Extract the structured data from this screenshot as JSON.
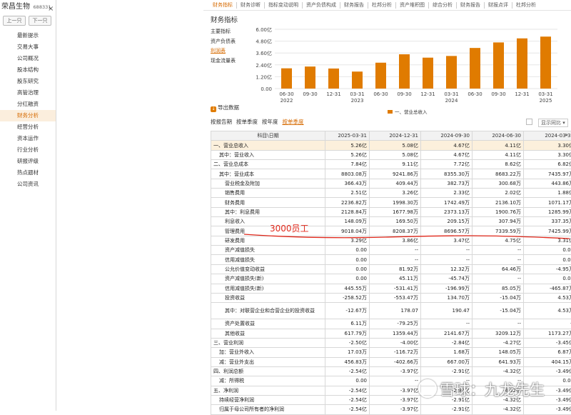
{
  "stock": {
    "name": "荣昌生物",
    "code": "688331",
    "close": "×"
  },
  "nav_buttons": {
    "prev": "上一只",
    "next": "下一只"
  },
  "sidebar": {
    "items": [
      {
        "label": "最新提示"
      },
      {
        "label": "交易大事"
      },
      {
        "label": "公司概况"
      },
      {
        "label": "股本结构"
      },
      {
        "label": "股东研究"
      },
      {
        "label": "高管治理"
      },
      {
        "label": "分红融资"
      },
      {
        "label": "财务分析",
        "active": true
      },
      {
        "label": "经营分析"
      },
      {
        "label": "资本运作"
      },
      {
        "label": "行业分析"
      },
      {
        "label": "研报评级"
      },
      {
        "label": "热点题材"
      },
      {
        "label": "公司资讯"
      }
    ]
  },
  "top_tabs": [
    "财务指标",
    "财务诊断",
    "指标变动说明",
    "资产负债构成",
    "财务报告",
    "杜邦分析",
    "资产堆积图",
    "综合分析",
    "财务报告",
    "财报点评",
    "杜邦分析"
  ],
  "section_title": "财务指标",
  "sub_tabs": [
    {
      "label": "主要指标"
    },
    {
      "label": "资产负债表"
    },
    {
      "label": "利润表",
      "active": true
    },
    {
      "label": "现金流量表"
    }
  ],
  "export_label": "导出数据",
  "export_icon": "download-icon",
  "period_tabs": [
    {
      "label": "按报告期"
    },
    {
      "label": "按单季度"
    },
    {
      "label": "按年度"
    },
    {
      "label": "按单季度",
      "active": true
    }
  ],
  "yoy": {
    "label": "显示同比",
    "checked": false
  },
  "more_arrow": "»",
  "accent_color": "#e07b00",
  "chart_data": {
    "type": "bar",
    "categories": [
      "06-30 2022",
      "09-30",
      "12-31",
      "03-31 2023",
      "06-30",
      "09-30",
      "12-31",
      "03-31 2024",
      "06-30",
      "09-30",
      "12-31",
      "03-31 2025"
    ],
    "x_tick_labels": [
      [
        "06-30",
        "2022"
      ],
      [
        "09-30",
        ""
      ],
      [
        "12-31",
        ""
      ],
      [
        "03-31",
        "2023"
      ],
      [
        "06-30",
        ""
      ],
      [
        "09-30",
        ""
      ],
      [
        "12-31",
        ""
      ],
      [
        "03-31",
        "2024"
      ],
      [
        "06-30",
        ""
      ],
      [
        "09-30",
        ""
      ],
      [
        "12-31",
        ""
      ],
      [
        "03-31",
        "2025"
      ]
    ],
    "series": [
      {
        "name": "一、营业总收入",
        "color": "#e07b00",
        "values": [
          2.05,
          2.23,
          2.03,
          1.72,
          2.62,
          3.47,
          3.13,
          3.3,
          4.11,
          4.67,
          5.08,
          5.26
        ]
      }
    ],
    "y_ticks": [
      "6.00亿",
      "4.80亿",
      "3.60亿",
      "2.40亿",
      "1.20亿",
      "0.00"
    ],
    "ylim": [
      0,
      6.0
    ],
    "grid": true,
    "legend_position": "bottom-right"
  },
  "table": {
    "header": [
      "科目\\日期",
      "2025-03-31",
      "2024-12-31",
      "2024-09-30",
      "2024-06-30",
      "2024-03-31"
    ],
    "rows": [
      {
        "cells": [
          "一、营业总收入",
          "5.26亿",
          "5.08亿",
          "4.67亿",
          "4.11亿",
          "3.30亿"
        ],
        "hl": true
      },
      {
        "cells": [
          "其中：营业收入",
          "5.26亿",
          "5.08亿",
          "4.67亿",
          "4.11亿",
          "3.30亿"
        ],
        "indent": 1
      },
      {
        "cells": [
          "二、营业总成本",
          "7.84亿",
          "9.11亿",
          "7.72亿",
          "8.62亿",
          "6.82亿"
        ]
      },
      {
        "cells": [
          "其中：营业成本",
          "8803.08万",
          "9241.86万",
          "8355.30万",
          "8683.22万",
          "7435.97万"
        ],
        "indent": 1
      },
      {
        "cells": [
          "营业税金及附加",
          "366.43万",
          "409.44万",
          "382.73万",
          "300.68万",
          "443.86万"
        ],
        "indent": 2
      },
      {
        "cells": [
          "销售费用",
          "2.51亿",
          "3.26亿",
          "2.33亿",
          "2.02亿",
          "1.88亿"
        ],
        "indent": 2
      },
      {
        "cells": [
          "财务费用",
          "2236.82万",
          "1998.30万",
          "1742.49万",
          "2136.10万",
          "1071.17万"
        ],
        "indent": 2
      },
      {
        "cells": [
          "其中：利息费用",
          "2128.84万",
          "1677.98万",
          "2373.13万",
          "1900.76万",
          "1285.99万"
        ],
        "indent": 2
      },
      {
        "cells": [
          "利息收入",
          "148.09万",
          "169.50万",
          "209.15万",
          "307.94万",
          "337.35万"
        ],
        "indent": 2
      },
      {
        "cells": [
          "管理费用",
          "9018.04万",
          "8208.37万",
          "8696.57万",
          "7339.59万",
          "7425.99万"
        ],
        "indent": 2
      },
      {
        "cells": [
          "研发费用",
          "3.29亿",
          "3.86亿",
          "3.47亿",
          "4.75亿",
          "3.31亿"
        ],
        "indent": 2
      },
      {
        "cells": [
          "资产减值损失",
          "0.00",
          "--",
          "--",
          "--",
          "0.00"
        ],
        "indent": 2
      },
      {
        "cells": [
          "信用减值损失",
          "0.00",
          "--",
          "--",
          "--",
          "0.00"
        ],
        "indent": 2
      },
      {
        "cells": [
          "公允价值变动收益",
          "0.00",
          "81.92万",
          "12.32万",
          "64.46万",
          "-4.95万"
        ],
        "indent": 2
      },
      {
        "cells": [
          "资产减值损失(新)",
          "0.00",
          "45.11万",
          "-45.74万",
          "--",
          "0.00"
        ],
        "indent": 2
      },
      {
        "cells": [
          "信用减值损失(新)",
          "445.55万",
          "-531.41万",
          "-196.99万",
          "85.05万",
          "-465.87万"
        ],
        "indent": 2
      },
      {
        "cells": [
          "投资收益",
          "-258.52万",
          "-553.47万",
          "134.70万",
          "-15.04万",
          "4.53万"
        ],
        "indent": 2
      },
      {
        "cells": [
          "其中：对联营企业和合营企业的投资收益",
          "-12.67万",
          "178.07",
          "190.47",
          "-15.04万",
          "4.53万"
        ],
        "indent": 2,
        "tall": true
      },
      {
        "cells": [
          "资产处置收益",
          "6.11万",
          "-79.25万",
          "--",
          "--",
          "--"
        ],
        "indent": 2
      },
      {
        "cells": [
          "其他收益",
          "617.79万",
          "1359.44万",
          "2141.67万",
          "3209.12万",
          "1173.27万"
        ],
        "indent": 2
      },
      {
        "cells": [
          "三、营业利润",
          "-2.50亿",
          "-4.00亿",
          "-2.84亿",
          "-4.27亿",
          "-3.45亿"
        ]
      },
      {
        "cells": [
          "加：营业外收入",
          "17.03万",
          "-116.72万",
          "1.68万",
          "148.05万",
          "6.87万"
        ],
        "indent": 1
      },
      {
        "cells": [
          "减：营业外支出",
          "456.83万",
          "-402.66万",
          "667.00万",
          "641.93万",
          "404.15万"
        ],
        "indent": 1
      },
      {
        "cells": [
          "四、利润总额",
          "-2.54亿",
          "-3.97亿",
          "-2.91亿",
          "-4.32亿",
          "-3.49亿"
        ]
      },
      {
        "cells": [
          "减：所得税",
          "0.00",
          "--",
          "--",
          "--",
          "0.00"
        ],
        "indent": 1
      },
      {
        "cells": [
          "五、净利润",
          "-2.54亿",
          "-3.97亿",
          "-2.91亿",
          "-4.32亿",
          "-3.49亿"
        ]
      },
      {
        "cells": [
          "持续经营净利润",
          "-2.54亿",
          "-3.97亿",
          "-2.91亿",
          "-4.32亿",
          "-3.49亿"
        ],
        "indent": 1
      },
      {
        "cells": [
          "归属于母公司所有者的净利润",
          "-2.54亿",
          "-3.97亿",
          "-2.91亿",
          "-4.32亿",
          "-3.49亿"
        ],
        "indent": 1
      }
    ]
  },
  "annotation": {
    "text": "3000员工",
    "color": "#e0281b"
  },
  "watermark": {
    "text": "雪球：九龙先生"
  }
}
